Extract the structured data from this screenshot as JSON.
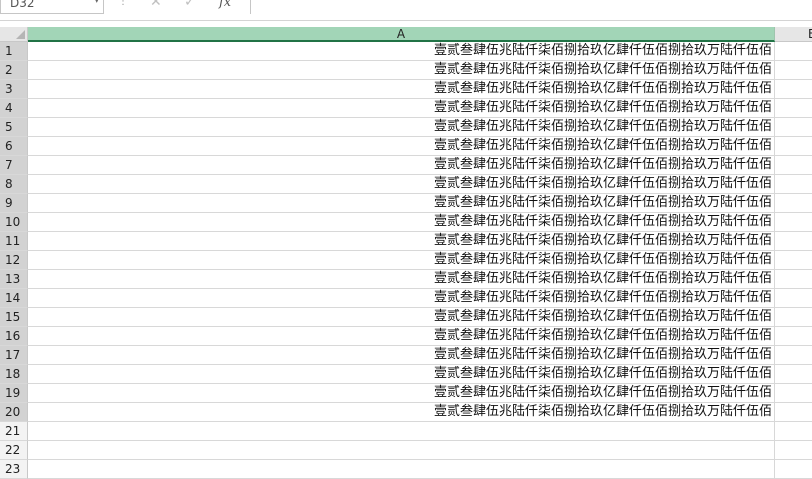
{
  "formula_bar": {
    "name_box": "D32",
    "name_box_arrow": "▾",
    "separator": "⋮",
    "cancel_icon": "✕",
    "enter_icon": "✓",
    "fx_label": "fx",
    "formula": ""
  },
  "columns": [
    {
      "label": "A"
    },
    {
      "label": "B"
    }
  ],
  "rows": [
    {
      "num": "1",
      "a": "壹贰叁肆伍兆陆仟柒佰捌拾玖亿肆仟伍佰捌拾玖万陆仟伍佰"
    },
    {
      "num": "2",
      "a": "壹贰叁肆伍兆陆仟柒佰捌拾玖亿肆仟伍佰捌拾玖万陆仟伍佰"
    },
    {
      "num": "3",
      "a": "壹贰叁肆伍兆陆仟柒佰捌拾玖亿肆仟伍佰捌拾玖万陆仟伍佰"
    },
    {
      "num": "4",
      "a": "壹贰叁肆伍兆陆仟柒佰捌拾玖亿肆仟伍佰捌拾玖万陆仟伍佰"
    },
    {
      "num": "5",
      "a": "壹贰叁肆伍兆陆仟柒佰捌拾玖亿肆仟伍佰捌拾玖万陆仟伍佰"
    },
    {
      "num": "6",
      "a": "壹贰叁肆伍兆陆仟柒佰捌拾玖亿肆仟伍佰捌拾玖万陆仟伍佰"
    },
    {
      "num": "7",
      "a": "壹贰叁肆伍兆陆仟柒佰捌拾玖亿肆仟伍佰捌拾玖万陆仟伍佰"
    },
    {
      "num": "8",
      "a": "壹贰叁肆伍兆陆仟柒佰捌拾玖亿肆仟伍佰捌拾玖万陆仟伍佰"
    },
    {
      "num": "9",
      "a": "壹贰叁肆伍兆陆仟柒佰捌拾玖亿肆仟伍佰捌拾玖万陆仟伍佰"
    },
    {
      "num": "10",
      "a": "壹贰叁肆伍兆陆仟柒佰捌拾玖亿肆仟伍佰捌拾玖万陆仟伍佰"
    },
    {
      "num": "11",
      "a": "壹贰叁肆伍兆陆仟柒佰捌拾玖亿肆仟伍佰捌拾玖万陆仟伍佰"
    },
    {
      "num": "12",
      "a": "壹贰叁肆伍兆陆仟柒佰捌拾玖亿肆仟伍佰捌拾玖万陆仟伍佰"
    },
    {
      "num": "13",
      "a": "壹贰叁肆伍兆陆仟柒佰捌拾玖亿肆仟伍佰捌拾玖万陆仟伍佰"
    },
    {
      "num": "14",
      "a": "壹贰叁肆伍兆陆仟柒佰捌拾玖亿肆仟伍佰捌拾玖万陆仟伍佰"
    },
    {
      "num": "15",
      "a": "壹贰叁肆伍兆陆仟柒佰捌拾玖亿肆仟伍佰捌拾玖万陆仟伍佰"
    },
    {
      "num": "16",
      "a": "壹贰叁肆伍兆陆仟柒佰捌拾玖亿肆仟伍佰捌拾玖万陆仟伍佰"
    },
    {
      "num": "17",
      "a": "壹贰叁肆伍兆陆仟柒佰捌拾玖亿肆仟伍佰捌拾玖万陆仟伍佰"
    },
    {
      "num": "18",
      "a": "壹贰叁肆伍兆陆仟柒佰捌拾玖亿肆仟伍佰捌拾玖万陆仟伍佰"
    },
    {
      "num": "19",
      "a": "壹贰叁肆伍兆陆仟柒佰捌拾玖亿肆仟伍佰捌拾玖万陆仟伍佰"
    },
    {
      "num": "20",
      "a": "壹贰叁肆伍兆陆仟柒佰捌拾玖亿肆仟伍佰捌拾玖万陆仟伍佰"
    },
    {
      "num": "21",
      "a": ""
    },
    {
      "num": "22",
      "a": ""
    },
    {
      "num": "23",
      "a": ""
    }
  ],
  "colors": {
    "selected_col_header": "#a2d5b7",
    "selected_col_border": "#217346",
    "header_bg": "#e6e6e6"
  }
}
